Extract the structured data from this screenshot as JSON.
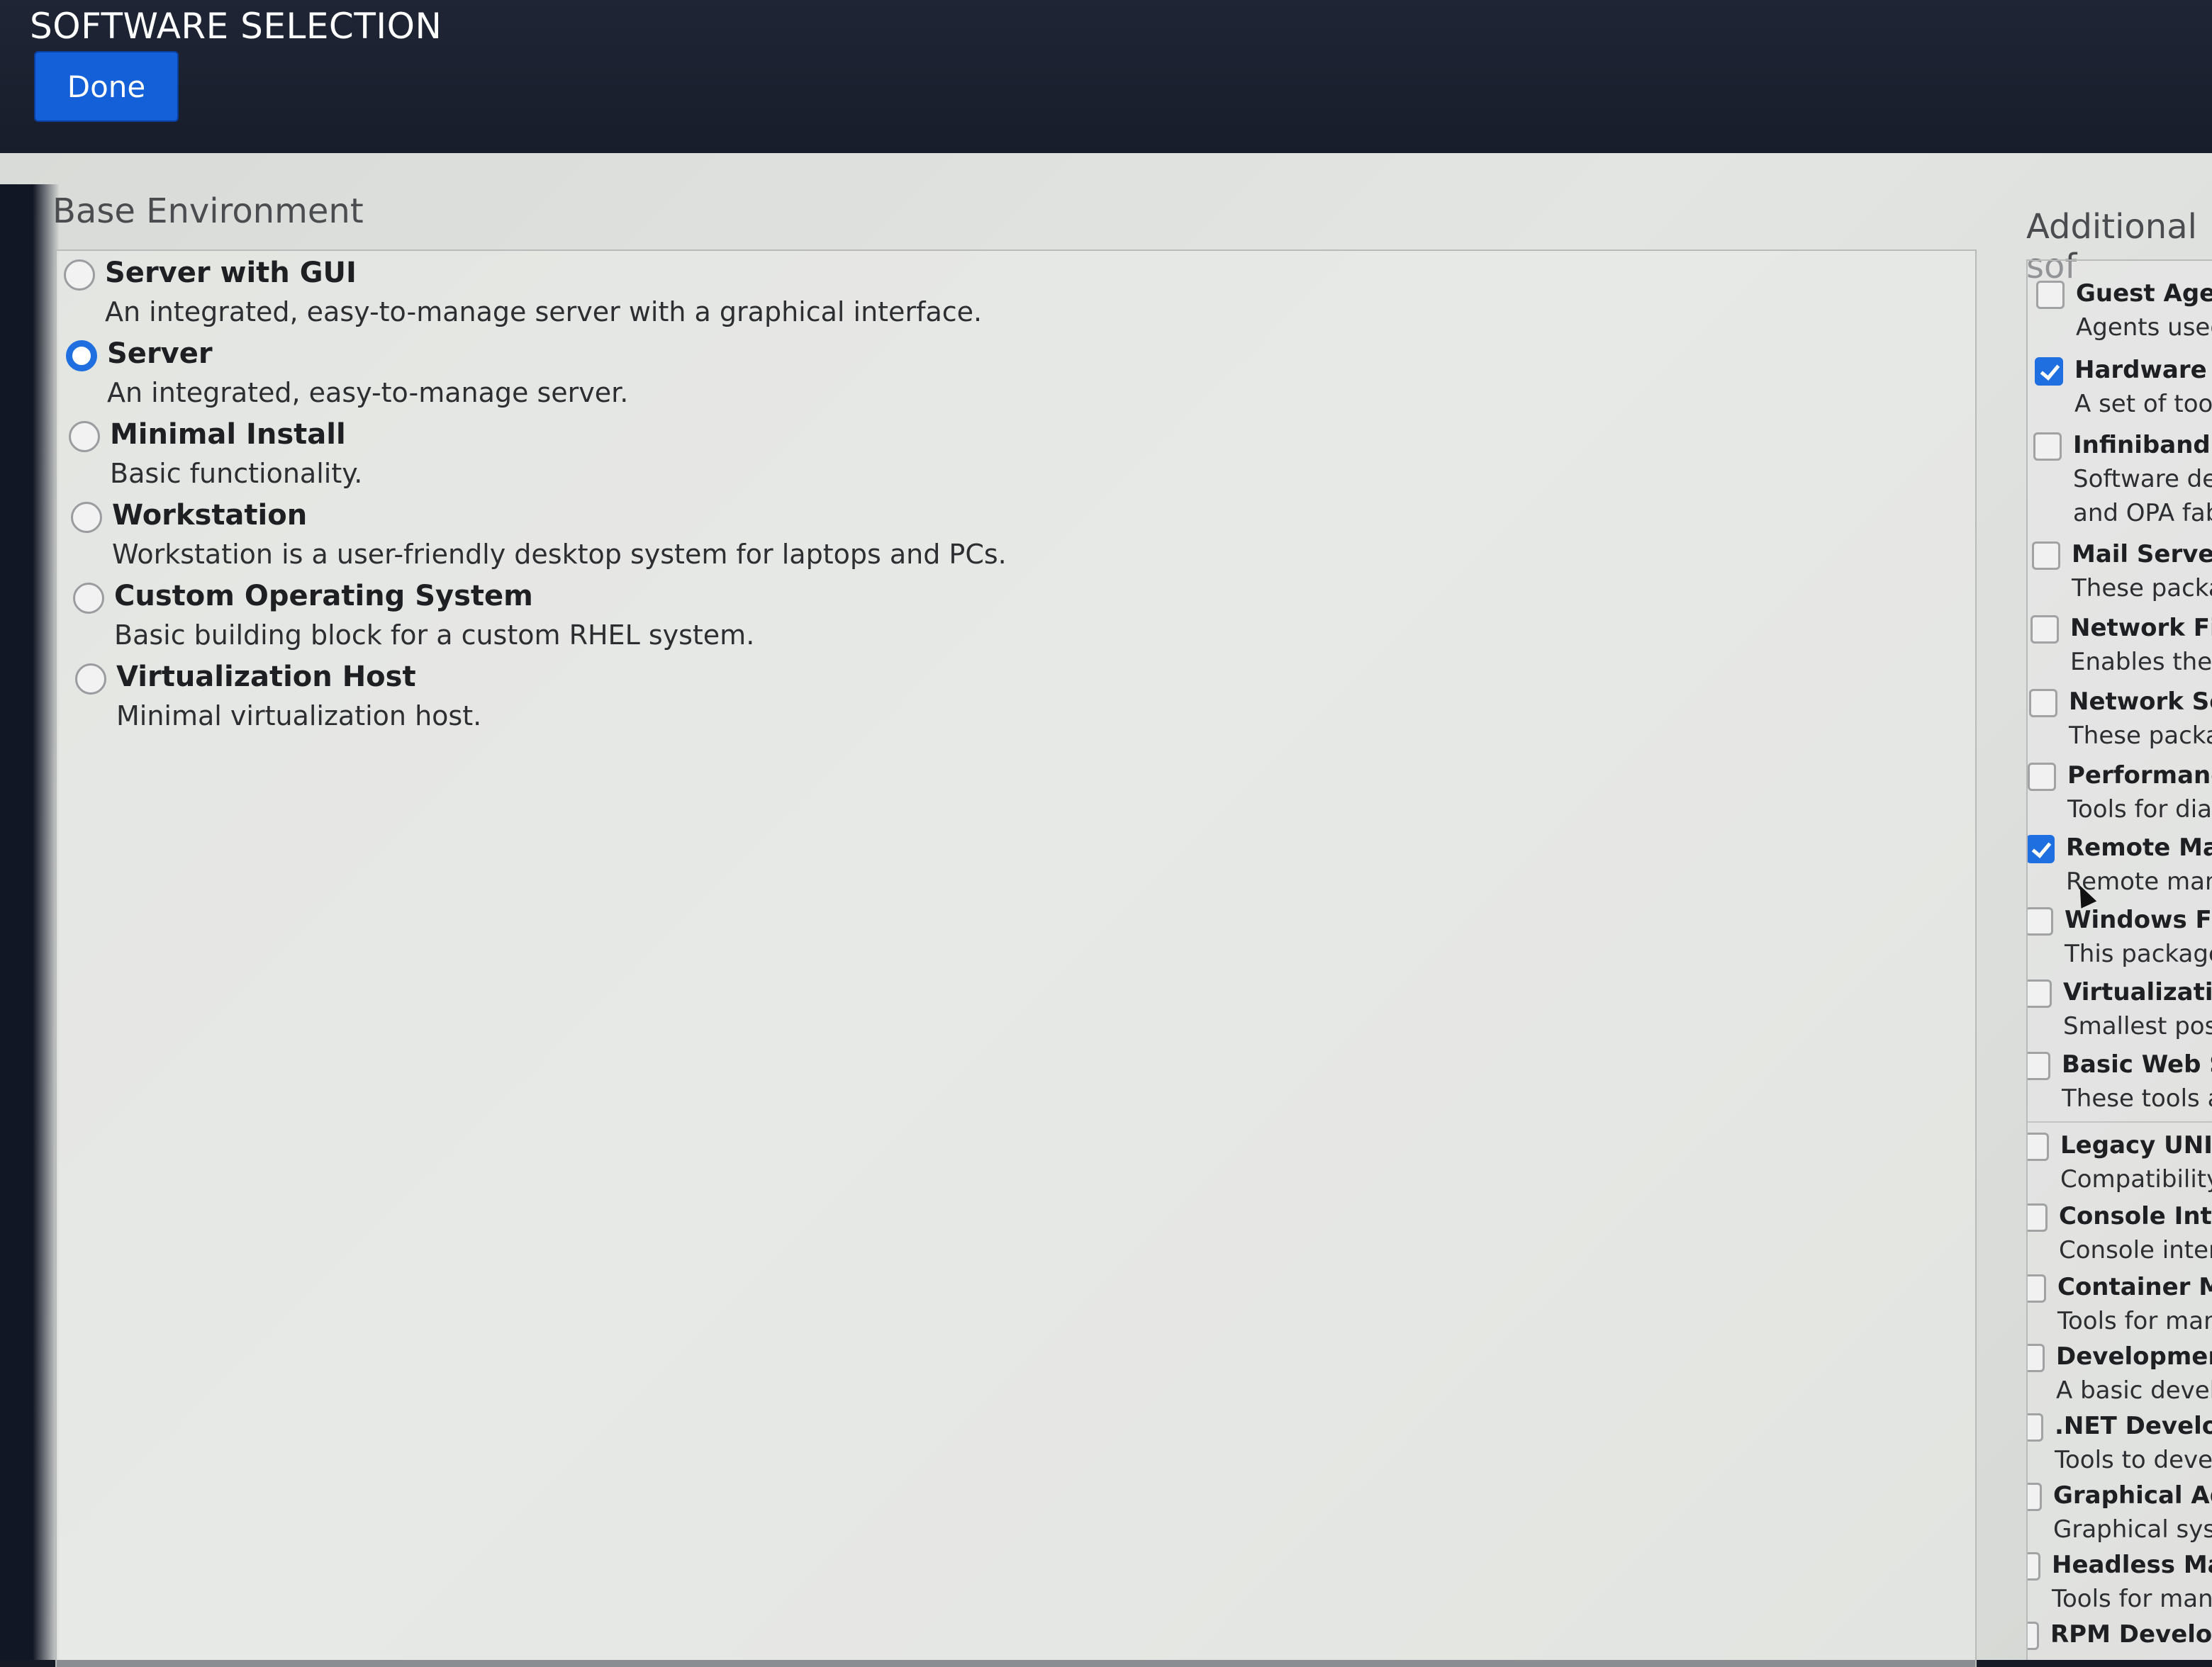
{
  "header": {
    "title": "SOFTWARE SELECTION",
    "done_label": "Done"
  },
  "base": {
    "title": "Base Environment",
    "items": [
      {
        "name": "Server with GUI",
        "desc": "An integrated, easy-to-manage server with a graphical interface.",
        "selected": false
      },
      {
        "name": "Server",
        "desc": "An integrated, easy-to-manage server.",
        "selected": true
      },
      {
        "name": "Minimal Install",
        "desc": "Basic functionality.",
        "selected": false
      },
      {
        "name": "Workstation",
        "desc": "Workstation is a user-friendly desktop system for laptops and PCs.",
        "selected": false
      },
      {
        "name": "Custom Operating System",
        "desc": "Basic building block for a custom RHEL system.",
        "selected": false
      },
      {
        "name": "Virtualization Host",
        "desc": "Minimal virtualization host.",
        "selected": false
      }
    ]
  },
  "addons": {
    "title": "Additional sof",
    "items": [
      {
        "name": "Guest Agent",
        "desc": "Agents used",
        "checked": false
      },
      {
        "name": "Hardware Mo",
        "desc": "A set of tools",
        "checked": true
      },
      {
        "name": "Infiniband Su",
        "desc": "Software desi",
        "desc2": "and OPA fabri",
        "checked": false
      },
      {
        "name": "Mail Server",
        "desc": "These packag",
        "checked": false
      },
      {
        "name": "Network File S",
        "desc": "Enables the sy",
        "checked": false
      },
      {
        "name": "Network Serv",
        "desc": "These package",
        "checked": false
      },
      {
        "name": "Performance T",
        "desc": "Tools for diagn",
        "checked": false
      },
      {
        "name": "Remote Manag",
        "desc": "Remote manag",
        "checked": true
      },
      {
        "name": "Windows File S",
        "desc": "This package gr",
        "checked": false
      },
      {
        "name": "Virtualization H",
        "desc": "Smallest possib",
        "checked": false
      },
      {
        "name": "Basic Web Serv",
        "desc": "These tools allo",
        "checked": false
      },
      {
        "name": "Legacy UNIX Co",
        "desc": "Compatibility pr",
        "checked": false
      },
      {
        "name": "Console Internet",
        "desc": "Console internet",
        "checked": false
      },
      {
        "name": "Container Manag",
        "desc": "Tools for managi",
        "checked": false
      },
      {
        "name": "Development To",
        "desc": "A basic developm",
        "checked": false
      },
      {
        ".NET": "",
        "name": ".NET Developme",
        "desc": "Tools to develop",
        "checked": false
      },
      {
        "name": "Graphical Admini",
        "desc": "Graphical system",
        "checked": false
      },
      {
        "name": "Headless Manage",
        "desc": "Tools for managin",
        "checked": false
      },
      {
        "name": "RPM Developmen",
        "desc": "",
        "checked": false
      }
    ]
  }
}
